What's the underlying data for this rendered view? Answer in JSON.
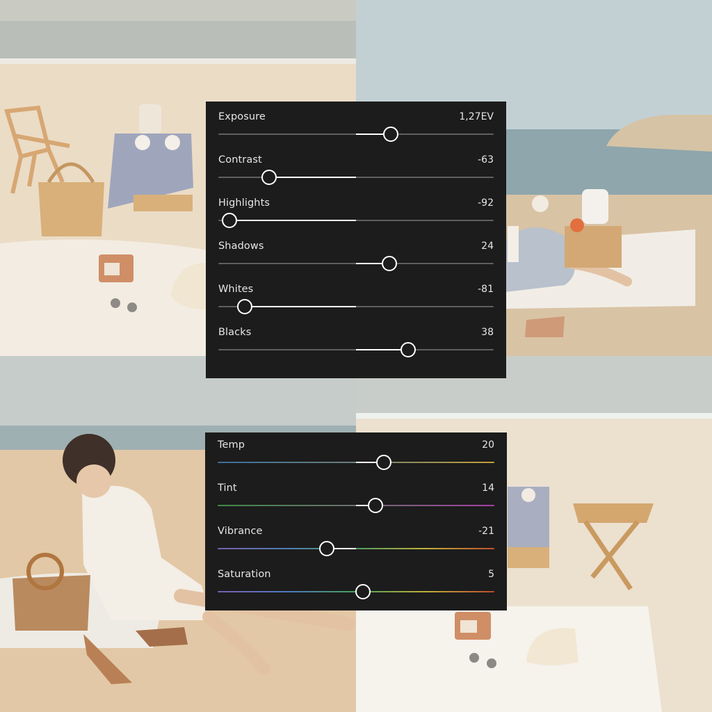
{
  "light_panel": {
    "sliders": [
      {
        "label": "Exposure",
        "value": "1,27EV",
        "level": 1.27,
        "min": -5,
        "max": 5
      },
      {
        "label": "Contrast",
        "value": "-63",
        "level": -63,
        "min": -100,
        "max": 100
      },
      {
        "label": "Highlights",
        "value": "-92",
        "level": -92,
        "min": -100,
        "max": 100
      },
      {
        "label": "Shadows",
        "value": "24",
        "level": 24,
        "min": -100,
        "max": 100
      },
      {
        "label": "Whites",
        "value": "-81",
        "level": -81,
        "min": -100,
        "max": 100
      },
      {
        "label": "Blacks",
        "value": "38",
        "level": 38,
        "min": -100,
        "max": 100
      }
    ]
  },
  "color_panel": {
    "sliders": [
      {
        "label": "Temp",
        "value": "20",
        "level": 20,
        "min": -100,
        "max": 100
      },
      {
        "label": "Tint",
        "value": "14",
        "level": 14,
        "min": -100,
        "max": 100
      },
      {
        "label": "Vibrance",
        "value": "-21",
        "level": -21,
        "min": -100,
        "max": 100
      },
      {
        "label": "Saturation",
        "value": "5",
        "level": 5,
        "min": -100,
        "max": 100
      }
    ]
  },
  "colors": {
    "panel_bg": "#1c1c1c",
    "track": "#5f5f5f",
    "fill": "#ffffff",
    "text": "#e6e6e6"
  }
}
